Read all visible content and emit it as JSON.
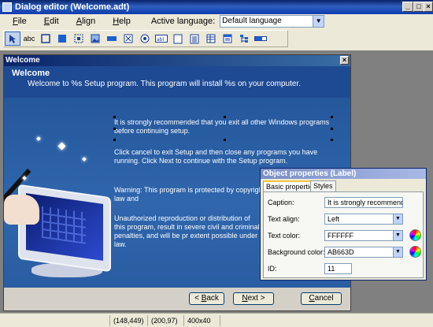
{
  "window": {
    "title": "Dialog editor (Welcome.adt)"
  },
  "menu": {
    "items": [
      {
        "key": "F",
        "rest": "ile"
      },
      {
        "key": "E",
        "rest": "dit"
      },
      {
        "key": "A",
        "rest": "lign"
      },
      {
        "key": "H",
        "rest": "elp"
      }
    ],
    "language_label": "Active language:",
    "language_value": "Default language"
  },
  "toolbar": {
    "tools": [
      "pointer-tool",
      "text-tool",
      "frame-tool",
      "panel-tool",
      "grid-tool",
      "image-tool",
      "edit-box-tool",
      "checkbox-tool",
      "radio-tool",
      "label-tool",
      "page-tool",
      "list-tool",
      "table-tool",
      "listview-tool",
      "tree-tool",
      "progress-tool"
    ]
  },
  "dialog": {
    "title": "Welcome",
    "header_title": "Welcome",
    "header_sub": "Welcome to %s Setup program. This program will install %s on your computer.",
    "para1": "It is strongly recommended that you exit all other Windows programs before continuing setup.",
    "para2": "Click cancel to exit Setup and then close any programs you have running. Click Next to continue with the Setup program.",
    "para3": "Warning: This program is protected by copyright law and",
    "para4": "Unauthorized reproduction or distribution of this program, result in severe civil and criminal penalties, and will be pr extent possible under law.",
    "back_key": "B",
    "back_rest": "ack",
    "next_key": "N",
    "next_rest": "ext",
    "cancel_key": "C",
    "cancel_rest": "ancel"
  },
  "props": {
    "title": "Object properties (Label)",
    "tabs": [
      "Basic properties",
      "Styles"
    ],
    "caption_label": "Caption:",
    "caption_value": "It is strongly recommended th",
    "align_label": "Text align:",
    "align_value": "Left",
    "color_label": "Text color:",
    "color_value": "FFFFFF",
    "bg_label": "Background color:",
    "bg_value": "AB663D",
    "id_label": "ID:",
    "id_value": "11"
  },
  "status": {
    "pos": "(148,449)",
    "pos2": "(200,97)",
    "size": "400x40"
  }
}
